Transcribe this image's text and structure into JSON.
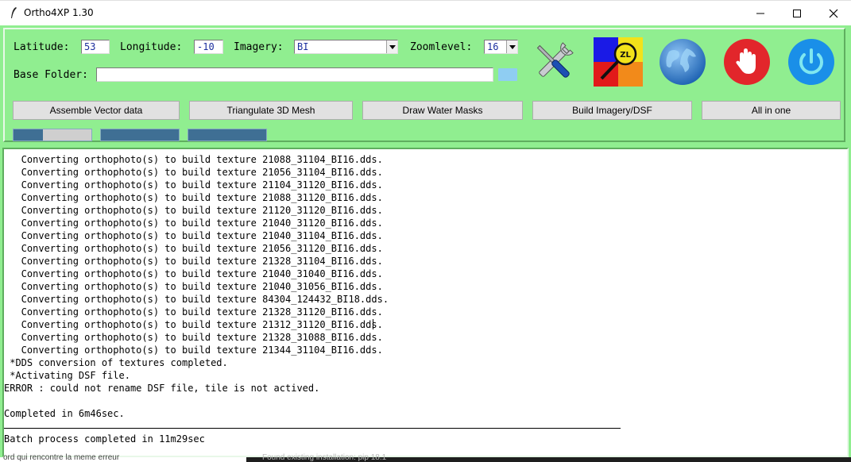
{
  "window": {
    "title": "Ortho4XP 1.30",
    "controls": {
      "minimize_icon": "minimize-icon",
      "maximize_icon": "maximize-icon",
      "close_icon": "close-icon"
    }
  },
  "form": {
    "latitude": {
      "label": "Latitude:",
      "value": "53"
    },
    "longitude": {
      "label": "Longitude:",
      "value": "-10"
    },
    "imagery": {
      "label": "Imagery:",
      "value": "BI"
    },
    "zoomlevel": {
      "label": "Zoomlevel:",
      "value": "16"
    },
    "base_folder": {
      "label": "Base Folder:",
      "value": ""
    }
  },
  "toolbar_icons": [
    "tools-icon",
    "zoomlevel-map-icon",
    "globe-icon",
    "stop-hand-icon",
    "power-icon"
  ],
  "zoom_icon_text": "ZL",
  "buttons": {
    "assemble": "Assemble Vector data",
    "triangulate": "Triangulate 3D Mesh",
    "water": "Draw Water Masks",
    "imagery": "Build Imagery/DSF",
    "allinone": "All in one"
  },
  "progress": [
    {
      "name": "progress-1",
      "value": 0.38
    },
    {
      "name": "progress-2",
      "value": 1.0
    },
    {
      "name": "progress-3",
      "value": 1.0
    }
  ],
  "console": {
    "lines": [
      "   Converting orthophoto(s) to build texture 21088_31104_BI16.dds.",
      "   Converting orthophoto(s) to build texture 21056_31104_BI16.dds.",
      "   Converting orthophoto(s) to build texture 21104_31120_BI16.dds.",
      "   Converting orthophoto(s) to build texture 21088_31120_BI16.dds.",
      "   Converting orthophoto(s) to build texture 21120_31120_BI16.dds.",
      "   Converting orthophoto(s) to build texture 21040_31120_BI16.dds.",
      "   Converting orthophoto(s) to build texture 21040_31104_BI16.dds.",
      "   Converting orthophoto(s) to build texture 21056_31120_BI16.dds.",
      "   Converting orthophoto(s) to build texture 21328_31104_BI16.dds.",
      "   Converting orthophoto(s) to build texture 21040_31040_BI16.dds.",
      "   Converting orthophoto(s) to build texture 21040_31056_BI16.dds.",
      "   Converting orthophoto(s) to build texture 84304_124432_BI18.dds.",
      "   Converting orthophoto(s) to build texture 21328_31120_BI16.dds.",
      "   Converting orthophoto(s) to build texture 21312_31120_BI16.dds.",
      "   Converting orthophoto(s) to build texture 21328_31088_BI16.dds.",
      "   Converting orthophoto(s) to build texture 21344_31104_BI16.dds.",
      " *DDS conversion of textures completed.",
      " *Activating DSF file.",
      "ERROR : could not rename DSF file, tile is not actived.",
      "",
      "Completed in 6m46sec.",
      "",
      "Batch process completed in 11m29sec"
    ]
  },
  "background_text": {
    "left": "ord qui rencontre la meme erreur",
    "right": "Found existing installation: pip 18.1"
  },
  "colors": {
    "panel_bg": "#90ee90",
    "entry_text": "#1c2e9e",
    "progress_fill": "#3f6f94",
    "globe_blue": "#1e6fc4",
    "stop_red": "#e2262b",
    "power_blue": "#1a8fe8"
  }
}
